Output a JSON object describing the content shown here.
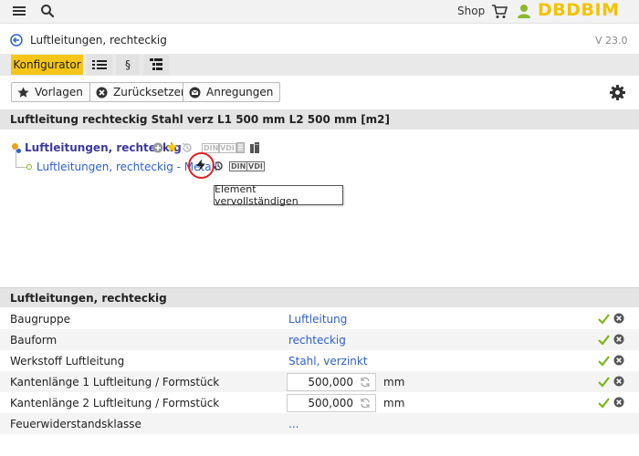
{
  "header": {
    "shop_label": "Shop",
    "logo": "DBDBIM",
    "icons": [
      "menu-icon",
      "search-icon",
      "cart-icon",
      "user-icon"
    ]
  },
  "title_bar": {
    "title": "Luftleitungen, rechteckig",
    "version": "V 23.0"
  },
  "tabs": [
    {
      "label": "Konfigurator",
      "active": true
    },
    {
      "icon": "list-icon"
    },
    {
      "label": "§"
    },
    {
      "icon": "structure-icon"
    }
  ],
  "toolbar": {
    "vorlagen": "Vorlagen",
    "zuruecksetzen": "Zurücksetzen",
    "anregungen": "Anregungen"
  },
  "section_title": "Luftleitung rechteckig Stahl verz L1 500 mm L2 500 mm [m2]",
  "tree": {
    "root": "Luftleitungen, rechteckig",
    "child": "Luftleitungen, rechteckig - Metall",
    "badge_din": "DIN",
    "badge_vdi": "VDI"
  },
  "tooltip": "Element vervollständigen",
  "properties": {
    "heading": "Luftleitungen, rechteckig",
    "rows": [
      {
        "label": "Baugruppe",
        "value": "Luftleitung"
      },
      {
        "label": "Bauform",
        "value": "rechteckig"
      },
      {
        "label": "Werkstoff Luftleitung",
        "value": "Stahl, verzinkt"
      },
      {
        "label": "Kantenlänge 1 Luftleitung / Formstück",
        "value": "500,000",
        "unit": "mm"
      },
      {
        "label": "Kantenlänge 2 Luftleitung / Formstück",
        "value": "500,000",
        "unit": "mm"
      },
      {
        "label": "Feuerwiderstandsklasse",
        "value": "..."
      }
    ]
  },
  "colors": {
    "accent": "#f5c518",
    "link": "#2d5fcc",
    "check": "#7cb518",
    "highlight_circle": "#e02020"
  }
}
